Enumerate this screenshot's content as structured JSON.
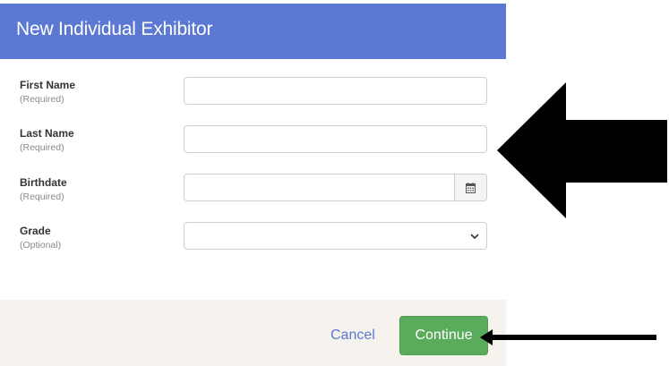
{
  "modal": {
    "title": "New Individual Exhibitor"
  },
  "fields": [
    {
      "name": "First Name",
      "requirement": "(Required)",
      "value": ""
    },
    {
      "name": "Last Name",
      "requirement": "(Required)",
      "value": ""
    },
    {
      "name": "Birthdate",
      "requirement": "(Required)",
      "value": ""
    },
    {
      "name": "Grade",
      "requirement": "(Optional)",
      "selected": ""
    }
  ],
  "footer": {
    "cancel_label": "Cancel",
    "continue_label": "Continue"
  },
  "icons": {
    "calendar": "calendar-icon",
    "select": "chevron-down-icon",
    "annotation_large": "arrow-left-icon",
    "annotation_small": "arrow-left-icon"
  },
  "colors": {
    "header": "#5b78d3",
    "continue": "#5bab5d",
    "cancel": "#5b78d3",
    "footer": "#f6f3ee",
    "annotation": "#000000"
  }
}
